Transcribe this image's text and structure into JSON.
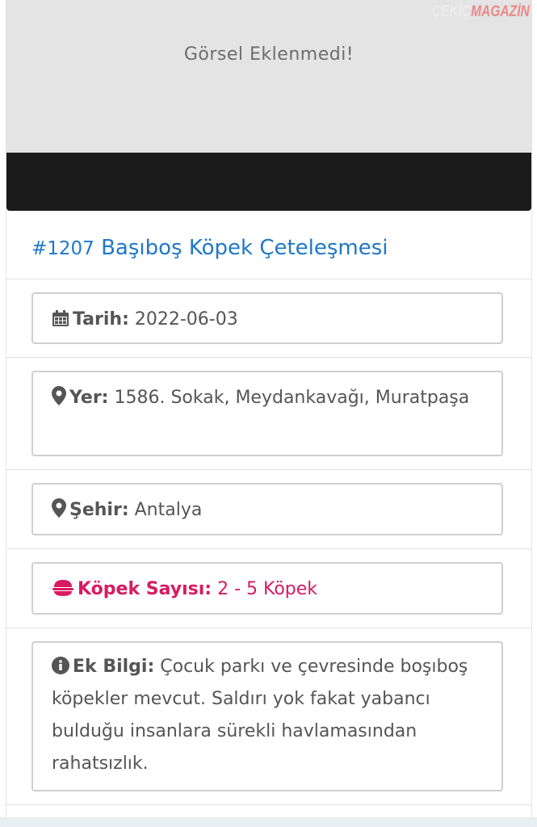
{
  "header": {
    "no_image_text": "Görsel Eklenmedi!",
    "watermark_part1": "ÇEKİÇ",
    "watermark_part2": "MAGAZİN"
  },
  "report": {
    "number": "#1207",
    "title": "Başıboş Köpek Çeteleşmesi"
  },
  "fields": {
    "date": {
      "label": "Tarih:",
      "value": "2022-06-03",
      "icon": "calendar-icon"
    },
    "place": {
      "label": "Yer:",
      "value": "1586. Sokak, Meydankavağı, Muratpaşa",
      "icon": "map-marker-icon"
    },
    "city": {
      "label": "Şehir:",
      "value": "Antalya",
      "icon": "map-marker-icon"
    },
    "dog_count": {
      "label": "Köpek Sayısı:",
      "value": "2 - 5 Köpek",
      "icon": "dog-bowl-icon",
      "color": "#d81b60"
    },
    "extra_info": {
      "label": "Ek Bilgi:",
      "value": "Çocuk parkı ve çevresinde boşıboş köpekler mevcut. Saldırı yok fakat yabancı bulduğu insanlara sürekli havlamasından rahatsızlık.",
      "icon": "info-circle-icon"
    }
  },
  "colors": {
    "title_blue": "#1f78c8",
    "accent_pink": "#d81b60",
    "image_placeholder": "#e4e4e4",
    "dark_bar": "#1b1b1b"
  }
}
